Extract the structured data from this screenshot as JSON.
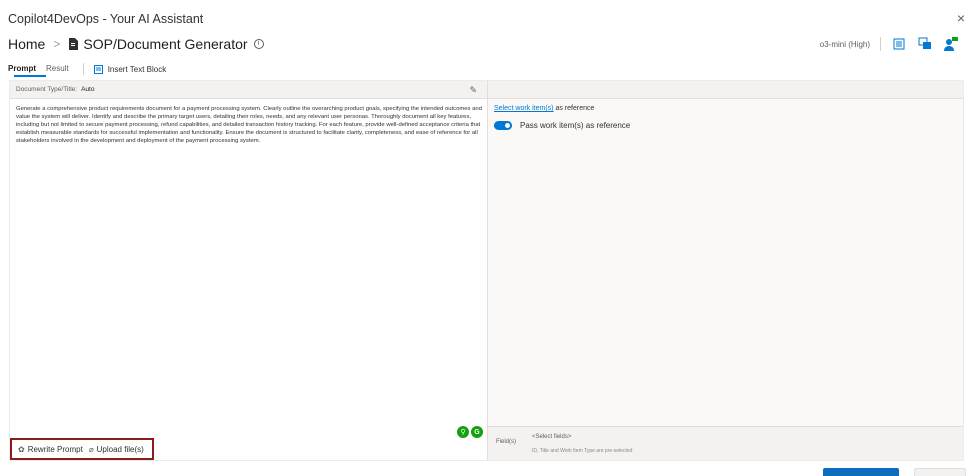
{
  "window": {
    "title": "Copilot4DevOps - Your AI Assistant",
    "close_label": "×"
  },
  "breadcrumb": {
    "home": "Home",
    "separator": ">",
    "current": "SOP/Document Generator",
    "info_icon": "info-icon"
  },
  "toolbar": {
    "model": "o3-mini (High)",
    "icons": [
      "settings-list-icon",
      "chat-translate-icon",
      "user-feedback-icon"
    ]
  },
  "tabs": [
    {
      "label": "Prompt",
      "active": true
    },
    {
      "label": "Result",
      "active": false
    }
  ],
  "insert_text_block": {
    "label": "Insert Text Block",
    "icon": "insert-block-icon"
  },
  "doc_type": {
    "label": "Document Type/Title:",
    "value": "Auto"
  },
  "prompt": {
    "text": "Generate a comprehensive product requirements document for a payment processing system. Clearly outline the overarching product goals, specifying the intended outcomes and value the system will deliver. Identify and describe the primary target users, detailing their roles, needs, and any relevant user personas. Thoroughly document all key features, including but not limited to secure payment processing, refund capabilities, and detailed transaction history tracking. For each feature, provide well-defined acceptance criteria that establish measurable standards for successful implementation and functionality. Ensure the document is structured to facilitate clarity, completeness, and ease of reference for all stakeholders involved in the development and deployment of the payment processing system."
  },
  "actions": {
    "rewrite_prompt": "Rewrite Prompt",
    "upload_files": "Upload file(s)"
  },
  "reference": {
    "link_text": "Select work item(s)",
    "suffix": "as reference",
    "toggle_label": "Pass work item(s) as reference",
    "toggle_on": true
  },
  "fields": {
    "label": "Field(s)",
    "placeholder": "<Select fields>",
    "note": "ID, Title and Work Item Type are pre-selected"
  },
  "colors": {
    "accent": "#0078d4",
    "highlight_border": "#8a1c1c",
    "assist_green": "#13a10e"
  }
}
